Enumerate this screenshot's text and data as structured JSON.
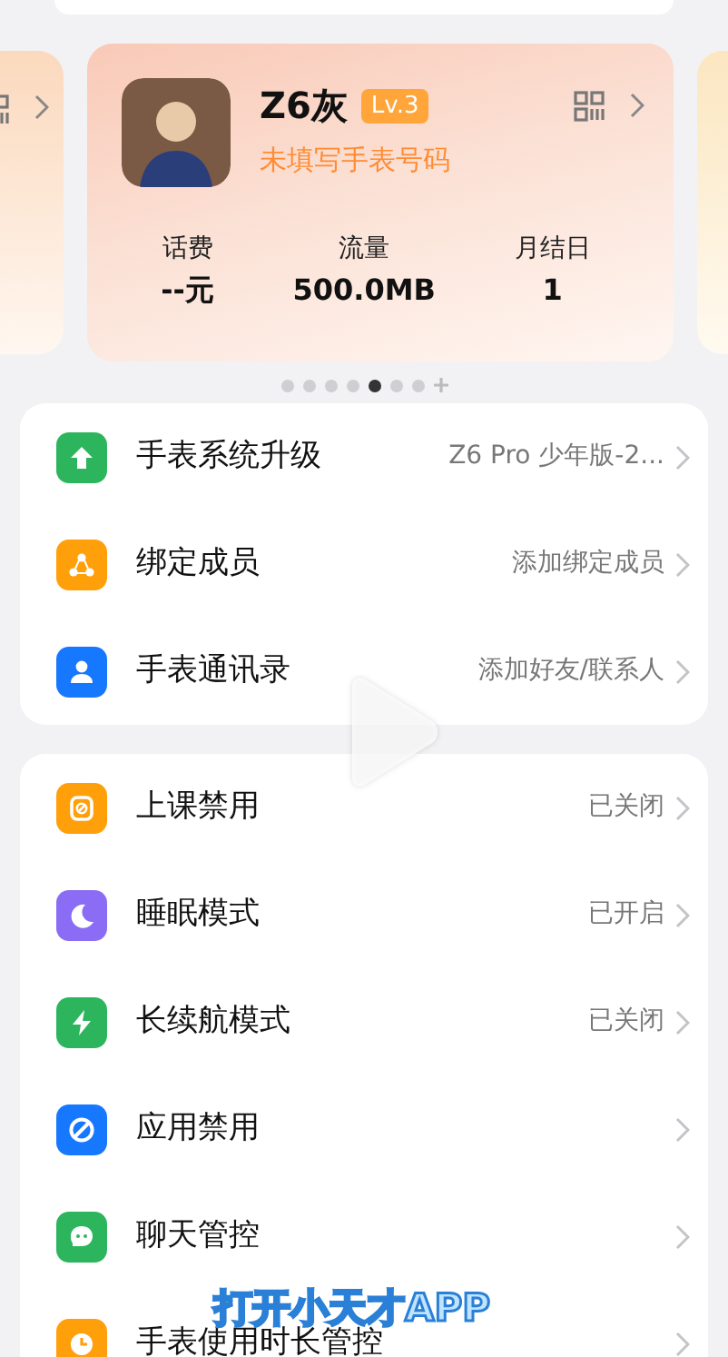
{
  "device_card": {
    "name": "Z6灰",
    "level_badge": "Lv.3",
    "phone_hint": "未填写手表号码",
    "stats": [
      {
        "label": "话费",
        "value": "--元"
      },
      {
        "label": "流量",
        "value": "500.0MB"
      },
      {
        "label": "月结日",
        "value": "1"
      }
    ]
  },
  "page_dots": [
    {
      "kind": "dot",
      "selected": false
    },
    {
      "kind": "dot",
      "selected": false
    },
    {
      "kind": "dot",
      "selected": false
    },
    {
      "kind": "dot",
      "selected": false
    },
    {
      "kind": "dot",
      "selected": true
    },
    {
      "kind": "dot",
      "selected": false
    },
    {
      "kind": "dot",
      "selected": false
    },
    {
      "kind": "add",
      "selected": false
    }
  ],
  "sections": [
    {
      "items": [
        {
          "kind": "upgrade",
          "color": "#2db55d",
          "label": "手表系统升级",
          "value": "Z6 Pro 少年版-2..."
        },
        {
          "kind": "members",
          "color": "#ff9f0a",
          "label": "绑定成员",
          "value": "添加绑定成员"
        },
        {
          "kind": "contact",
          "color": "#1677ff",
          "label": "手表通讯录",
          "value": "添加好友/联系人"
        }
      ]
    },
    {
      "items": [
        {
          "kind": "class",
          "color": "#ff9f0a",
          "label": "上课禁用",
          "value": "已关闭"
        },
        {
          "kind": "moon",
          "color": "#8a6cf5",
          "label": "睡眠模式",
          "value": "已开启"
        },
        {
          "kind": "bolt",
          "color": "#2db55d",
          "label": "长续航模式",
          "value": "已关闭"
        },
        {
          "kind": "block",
          "color": "#1677ff",
          "label": "应用禁用"
        },
        {
          "kind": "chat",
          "color": "#2db55d",
          "label": "聊天管控"
        },
        {
          "kind": "clock",
          "color": "#ff9f0a",
          "label": "手表使用时长管控"
        }
      ]
    }
  ],
  "video_overlay": {
    "caption": "打开小天才APP"
  }
}
